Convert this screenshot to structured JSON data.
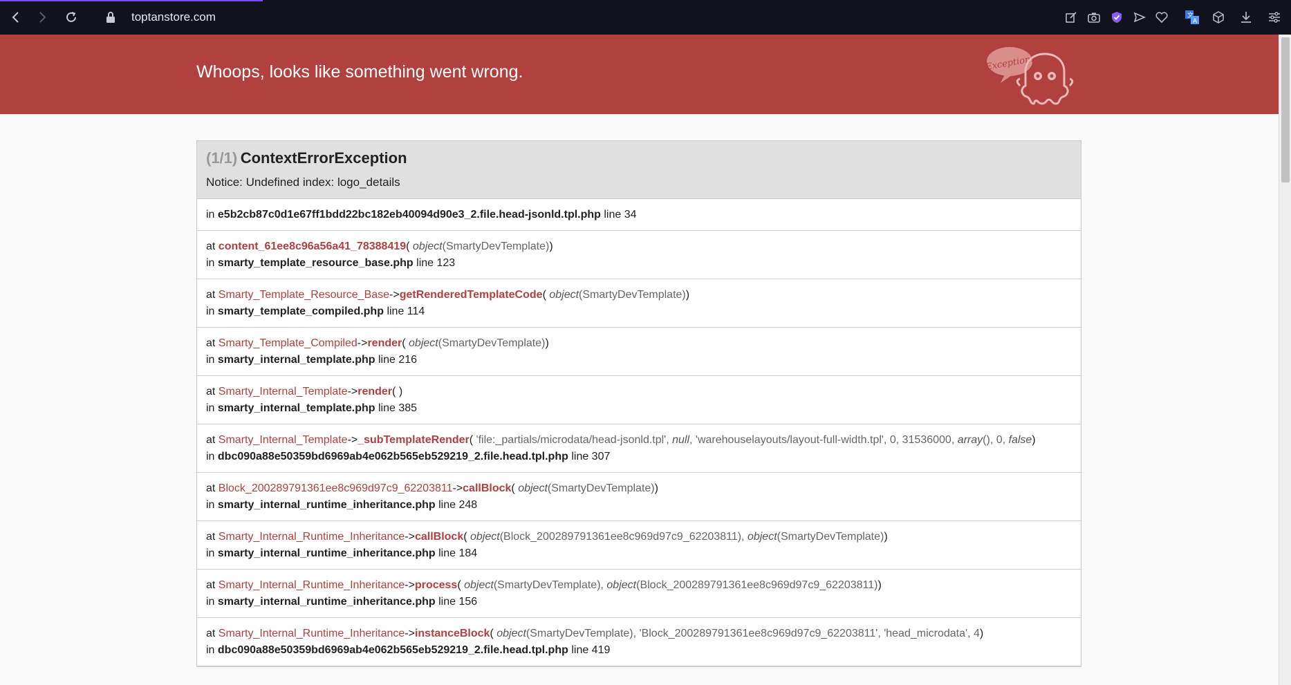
{
  "browser": {
    "url": "toptanstore.com",
    "icons": [
      "back-icon",
      "forward-icon",
      "reload-icon",
      "lock-icon",
      "pencil-icon",
      "camera-icon",
      "shield-icon",
      "send-icon",
      "heart-icon",
      "translate-icon",
      "cube-icon",
      "download-icon",
      "menu-icon"
    ]
  },
  "banner": {
    "title": "Whoops, looks like something went wrong.",
    "ghost_bubble": "Exception!"
  },
  "exception": {
    "count": "(1/1)",
    "class": "ContextErrorException",
    "message": "Notice: Undefined index: logo_details"
  },
  "labels": {
    "in": "in",
    "at": "at",
    "line": "line",
    "arrow": "->"
  },
  "trace": [
    {
      "at": null,
      "file": "e5b2cb87c0d1e67ff1bdd22bc182eb40094d90e3_2.file.head-jsonld.tpl.php",
      "line": "34"
    },
    {
      "at": {
        "cls": "",
        "fn": "content_61ee8c96a56a41_78388419",
        "args": "( object(SmartyDevTemplate))"
      },
      "file": "smarty_template_resource_base.php",
      "line": "123"
    },
    {
      "at": {
        "cls": "Smarty_Template_Resource_Base",
        "fn": "getRenderedTemplateCode",
        "args": "( object(SmartyDevTemplate))"
      },
      "file": "smarty_template_compiled.php",
      "line": "114"
    },
    {
      "at": {
        "cls": "Smarty_Template_Compiled",
        "fn": "render",
        "args": "( object(SmartyDevTemplate))"
      },
      "file": "smarty_internal_template.php",
      "line": "216"
    },
    {
      "at": {
        "cls": "Smarty_Internal_Template",
        "fn": "render",
        "args": "( )"
      },
      "file": "smarty_internal_template.php",
      "line": "385"
    },
    {
      "at": {
        "cls": "Smarty_Internal_Template",
        "fn": "_subTemplateRender",
        "args": "( 'file:_partials/microdata/head-jsonld.tpl', null, 'warehouselayouts/layout-full-width.tpl', 0, 31536000, array(), 0, false)"
      },
      "file": "dbc090a88e50359bd6969ab4e062b565eb529219_2.file.head.tpl.php",
      "line": "307"
    },
    {
      "at": {
        "cls": "Block_200289791361ee8c969d97c9_62203811",
        "fn": "callBlock",
        "args": "( object(SmartyDevTemplate))"
      },
      "file": "smarty_internal_runtime_inheritance.php",
      "line": "248"
    },
    {
      "at": {
        "cls": "Smarty_Internal_Runtime_Inheritance",
        "fn": "callBlock",
        "args": "( object(Block_200289791361ee8c969d97c9_62203811), object(SmartyDevTemplate))"
      },
      "file": "smarty_internal_runtime_inheritance.php",
      "line": "184"
    },
    {
      "at": {
        "cls": "Smarty_Internal_Runtime_Inheritance",
        "fn": "process",
        "args": "( object(SmartyDevTemplate), object(Block_200289791361ee8c969d97c9_62203811))"
      },
      "file": "smarty_internal_runtime_inheritance.php",
      "line": "156"
    },
    {
      "at": {
        "cls": "Smarty_Internal_Runtime_Inheritance",
        "fn": "instanceBlock",
        "args": "( object(SmartyDevTemplate), 'Block_200289791361ee8c969d97c9_62203811', 'head_microdata', 4)"
      },
      "file": "dbc090a88e50359bd6969ab4e062b565eb529219_2.file.head.tpl.php",
      "line": "419"
    }
  ]
}
